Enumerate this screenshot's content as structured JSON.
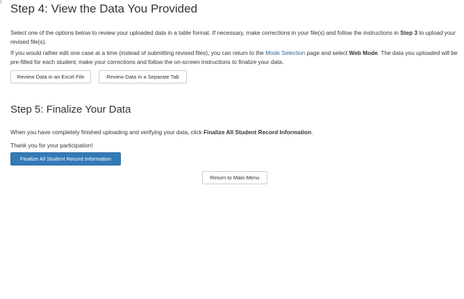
{
  "step4": {
    "title": "Step 4: View the Data You Provided",
    "para1_before": "Select one of the options below to review your uploaded data in a table format. If necessary, make corrections in your file(s) and follow the instructions in ",
    "para1_bold": "Step 3",
    "para1_after": " to upload your revised file(s).",
    "para2_before": "If you would rather edit one case at a time (instead of submitting revised files), you can return to the ",
    "para2_link": "Mode Selection",
    "para2_middle": " page and select ",
    "para2_bold": "Web Mode",
    "para2_after": ". The data you uploaded will be pre-filled for each student; make your corrections and follow the on-screen instructions to finalize your data.",
    "buttons": {
      "excel": "Review Data in an Excel File",
      "separate_tab": "Review Data in a Separate Tab"
    }
  },
  "step5": {
    "title": "Step 5: Finalize Your Data",
    "para1_before": "When you have completely finished uploading and verifying your data, click ",
    "para1_bold": "Finalize All Student Record Information",
    "para1_after": ".",
    "thanks": "Thank you for your participation!",
    "finalize_button": "Finalize All Student Record Information"
  },
  "return_button": "Return to Main Menu",
  "colors": {
    "primary": "#337ab7",
    "link": "#2a6496",
    "text": "#333333"
  }
}
